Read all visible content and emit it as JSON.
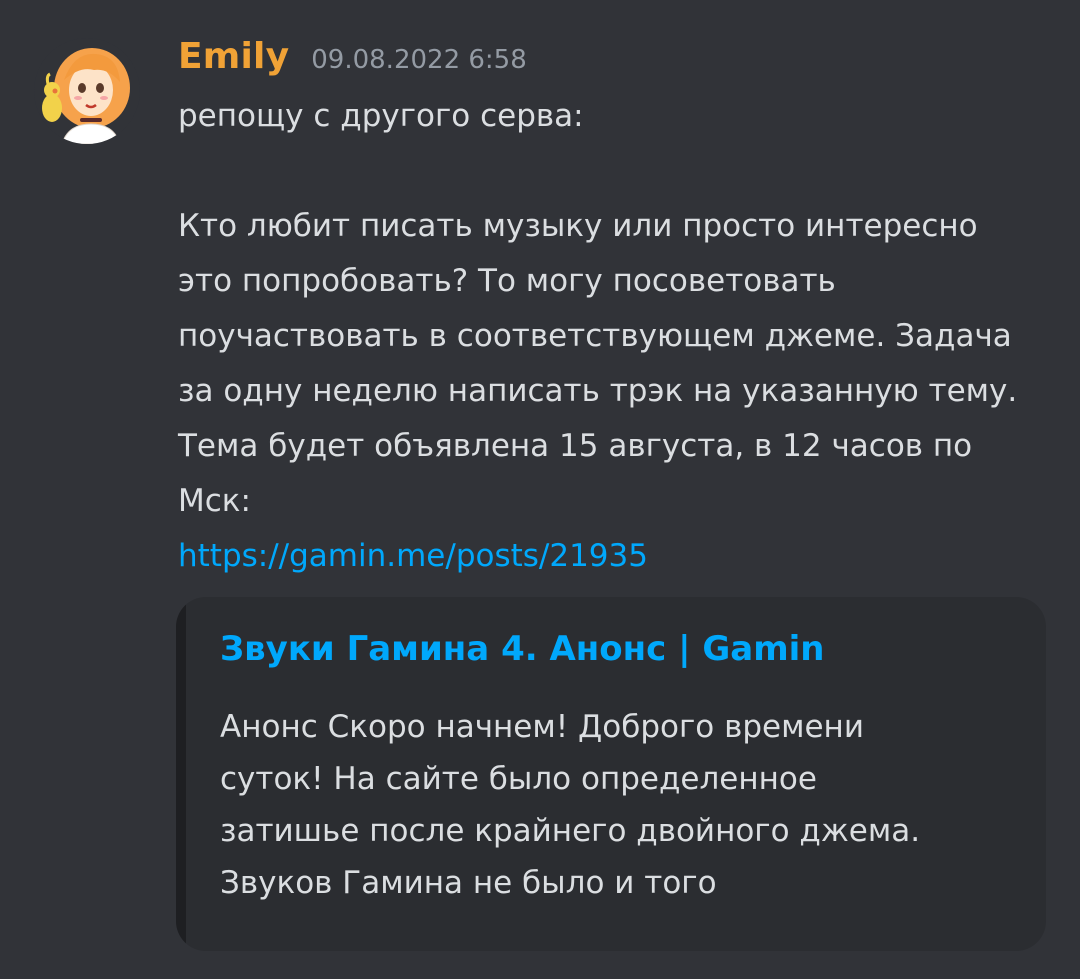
{
  "message": {
    "author": "Emily",
    "timestamp": "09.08.2022 6:58",
    "paragraphs": [
      "репощу с другого серва:",
      "",
      "Кто любит писать музыку или просто интересно\nэто попробовать? То могу посоветовать\nпоучаствовать в соответствующем джеме. Задача\nза одну неделю написать трэк на указанную тему.\nТема будет объявлена 15 августа, в 12 часов по\nМск:"
    ],
    "link": "https://gamin.me/posts/21935"
  },
  "embed": {
    "title": "Звуки Гамина 4. Анонс | Gamin",
    "description": "Анонс Скоро начнем! Доброго времени\nсуток! На сайте было определенное\nзатишье после крайнего двойного джема.\nЗвуков Гамина не было и того"
  },
  "colors": {
    "background": "#313338",
    "username": "#f0a236",
    "link": "#00a8fc",
    "embed_background": "#2b2d31"
  }
}
